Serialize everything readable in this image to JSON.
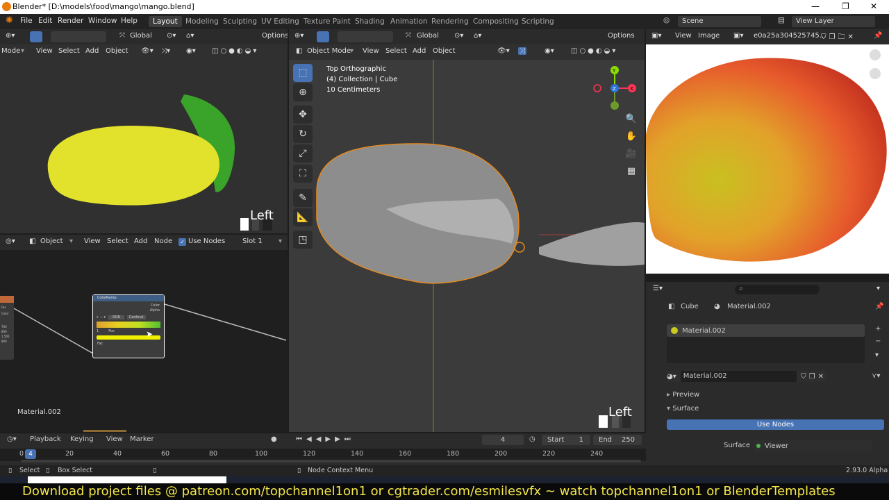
{
  "window": {
    "title": "Blender* [D:\\models\\food\\mango\\mango.blend]",
    "min": "—",
    "max": "❐",
    "close": "✕"
  },
  "menu": {
    "items": [
      "File",
      "Edit",
      "Render",
      "Window",
      "Help"
    ]
  },
  "workspaces": [
    "Layout",
    "Modeling",
    "Sculpting",
    "UV Editing",
    "Texture Paint",
    "Shading",
    "Animation",
    "Rendering",
    "Compositing",
    "Scripting"
  ],
  "scene": {
    "label": "Scene",
    "view_layer": "View Layer"
  },
  "left_viewport": {
    "header": {
      "global": "Global",
      "options": "Options",
      "mode": "Mode",
      "view": "View",
      "select": "Select",
      "add": "Add",
      "object": "Object"
    },
    "view_label": "Left"
  },
  "node_editor": {
    "header": {
      "editor": "Object",
      "view": "View",
      "select": "Select",
      "add": "Add",
      "node": "Node",
      "use_nodes": "Use Nodes",
      "slot": "Slot 1"
    },
    "node": {
      "title": "ColorRamp",
      "out_color": "Color",
      "out_alpha": "Alpha",
      "mode": "RGB",
      "interp": "Cardinal",
      "pos": "Pos",
      "in_fac": "Fac",
      "index": "1"
    },
    "material_label": "Material.002",
    "left_node_sockets": [
      "Fac",
      "Color"
    ],
    "left_node_vals": [
      "700",
      "800",
      "1.500",
      "800"
    ]
  },
  "main_viewport": {
    "header": {
      "global": "Global",
      "options": "Options",
      "mode": "Object Mode",
      "view": "View",
      "select": "Select",
      "add": "Add",
      "object": "Object"
    },
    "info": [
      "Top Orthographic",
      "(4) Collection | Cube",
      "10 Centimeters"
    ],
    "view_label": "Left",
    "gizmo": {
      "y": "Y",
      "z": "Z",
      "x": "X"
    }
  },
  "image_editor": {
    "view": "View",
    "image": "Image",
    "name": "e0a25a304525745..."
  },
  "properties": {
    "breadcrumb_obj": "Cube",
    "breadcrumb_mat": "Material.002",
    "material_slot": "Material.002",
    "material_name": "Material.002",
    "preview": "Preview",
    "surface_panel": "Surface",
    "use_nodes": "Use Nodes",
    "surface_label": "Surface",
    "surface_value": "Viewer",
    "colors": {
      "mat_dot": "#c9c91e",
      "accent": "#4772b3"
    }
  },
  "timeline": {
    "playback": "Playback",
    "keying": "Keying",
    "view": "View",
    "marker": "Marker",
    "frame": "4",
    "start_label": "Start",
    "start": "1",
    "end_label": "End",
    "end": "250",
    "ticks": [
      "0",
      "20",
      "40",
      "60",
      "80",
      "100",
      "120",
      "140",
      "160",
      "180",
      "200",
      "220",
      "240"
    ],
    "current": "4"
  },
  "status": {
    "select": "Select",
    "box_select": "Box Select",
    "node_menu": "Node Context Menu",
    "version": "2.93.0 Alpha"
  },
  "banner": "Download project files @ patreon.com/topchannel1on1 or cgtrader.com/esmilesvfx  ~ watch topchannel1on1 or BlenderTemplates"
}
